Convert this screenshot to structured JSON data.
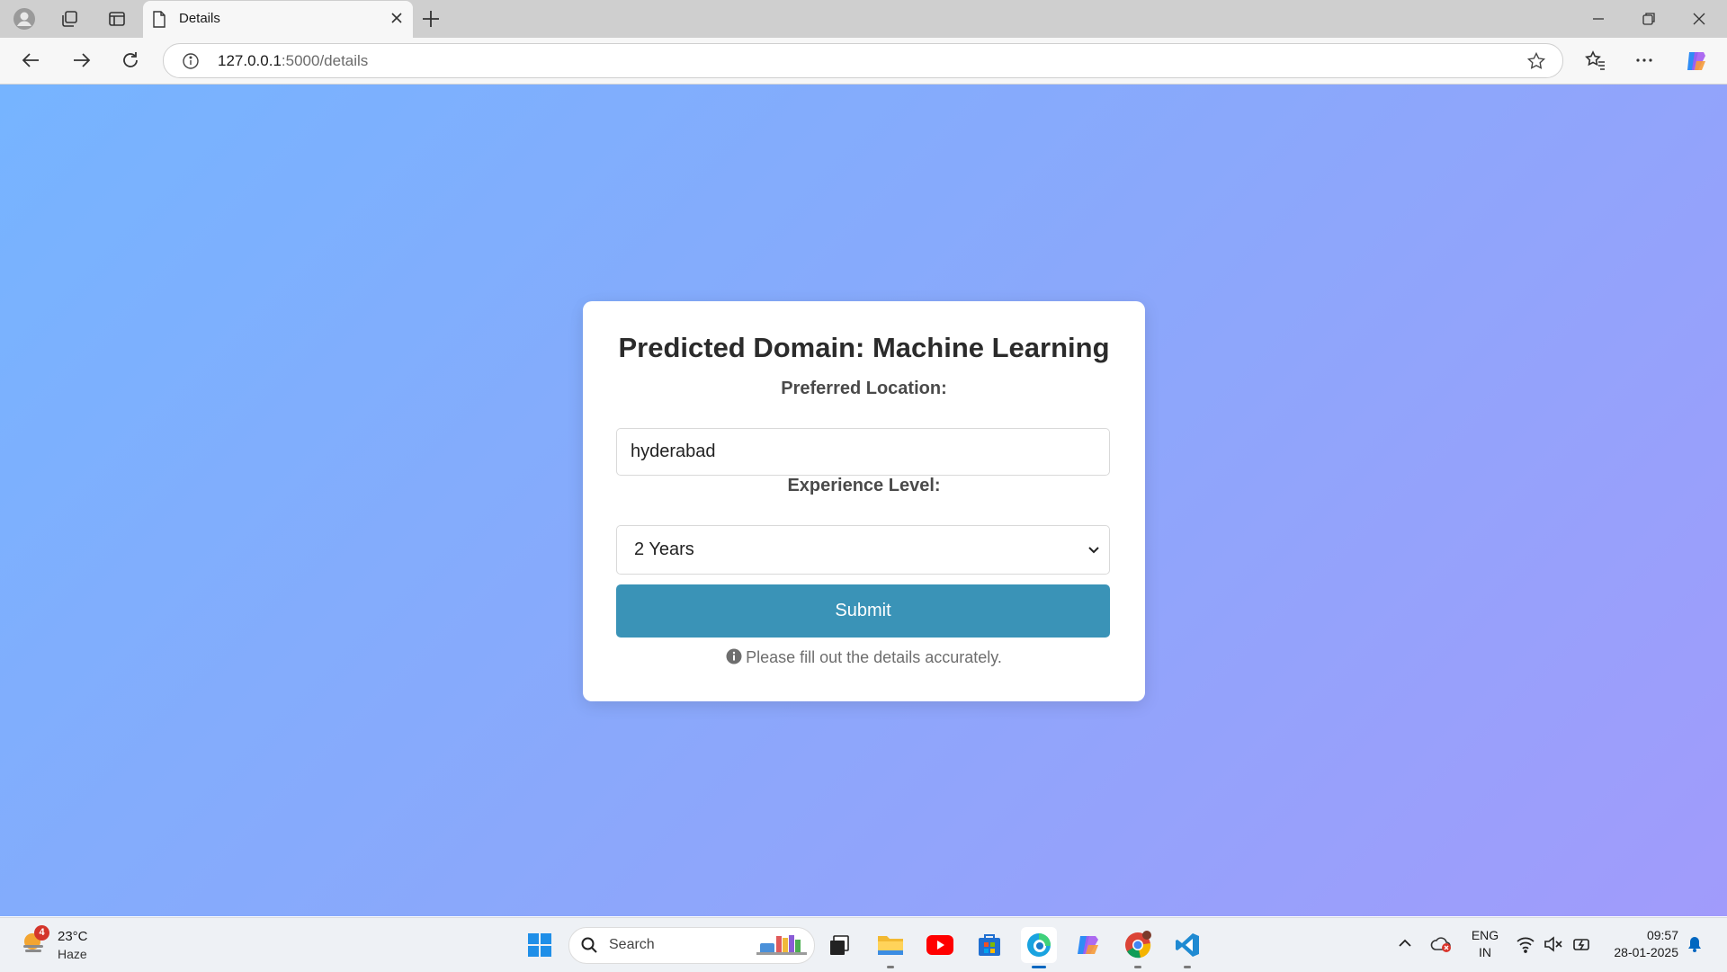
{
  "browser": {
    "tab_title": "Details",
    "address_host": "127.0.0.1",
    "address_rest": ":5000/details"
  },
  "card": {
    "title": "Predicted Domain: Machine Learning",
    "location_label": "Preferred Location:",
    "location_value": "hyderabad",
    "experience_label": "Experience Level:",
    "experience_value": "2 Years",
    "submit_label": "Submit",
    "hint_text": "Please fill out the details accurately."
  },
  "taskbar": {
    "weather_badge": "4",
    "weather_temp": "23°C",
    "weather_condition": "Haze",
    "search_placeholder": "Search",
    "lang_line1": "ENG",
    "lang_line2": "IN",
    "time": "09:57",
    "date": "28-01-2025"
  },
  "colors": {
    "accent_button": "#3a93b7",
    "gradient_start": "#76b4ff",
    "gradient_end": "#a19bfb"
  }
}
